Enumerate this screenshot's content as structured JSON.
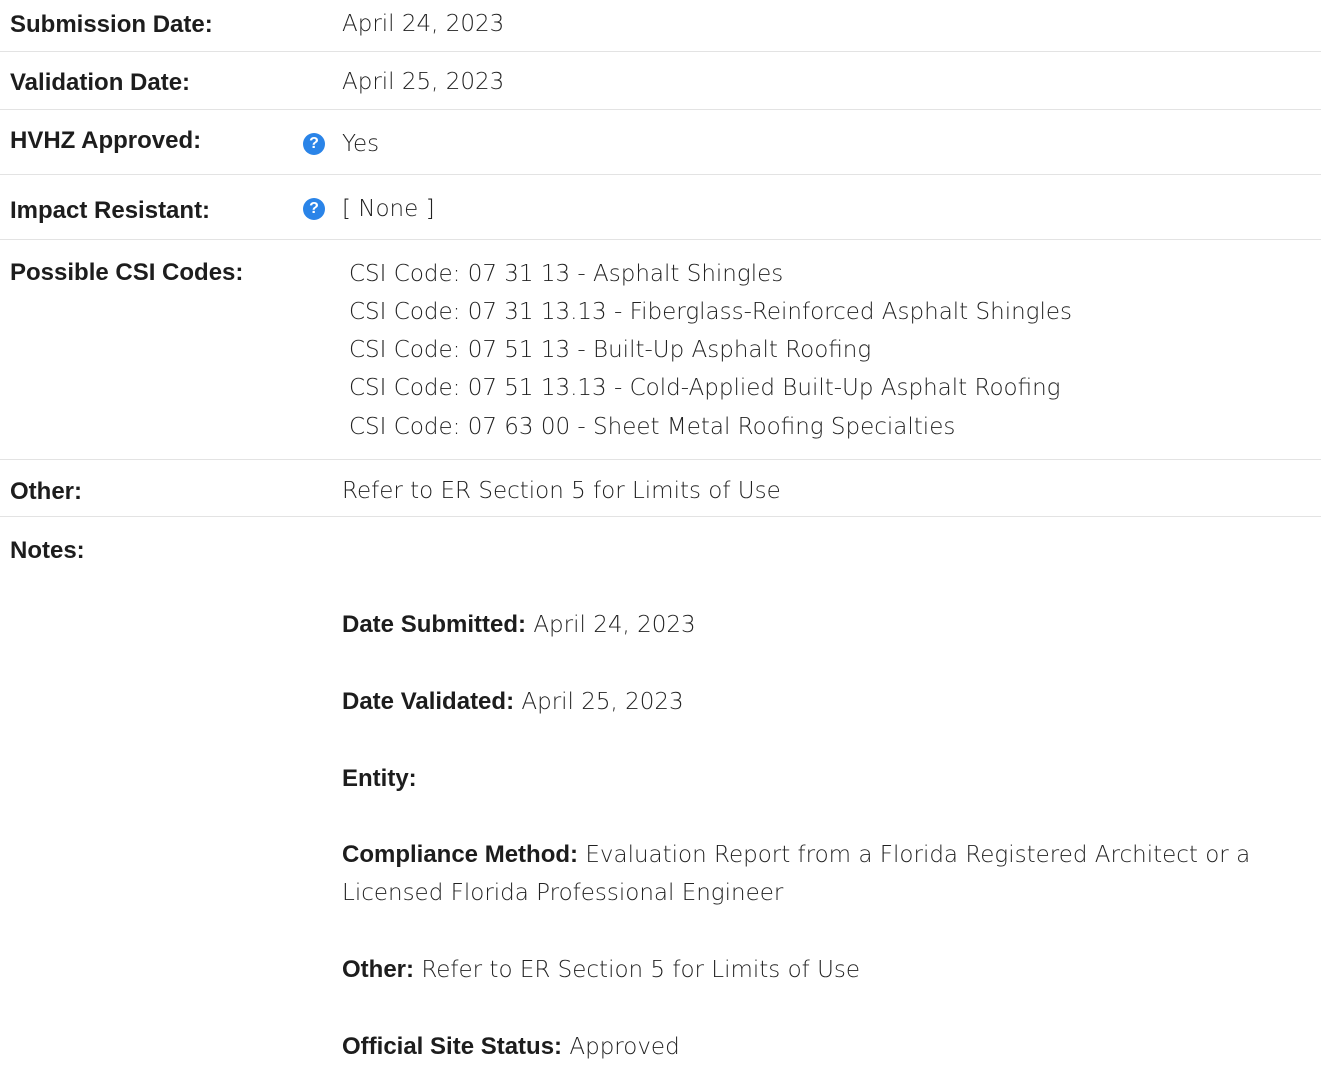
{
  "rows": {
    "submission": {
      "label": "Submission Date:",
      "value": "April 24, 2023"
    },
    "validation": {
      "label": "Validation Date:",
      "value": "April 25, 2023"
    },
    "hvhz": {
      "label": "HVHZ Approved:",
      "value": "Yes",
      "icon": "question-circle-icon"
    },
    "impact": {
      "label": "Impact Resistant:",
      "value": "[ None ]",
      "icon": "question-circle-icon"
    },
    "csi": {
      "label": "Possible CSI Codes:",
      "codes": [
        "CSI Code: 07 31 13 - Asphalt Shingles",
        "CSI Code: 07 31 13.13 - Fiberglass-Reinforced Asphalt Shingles",
        "CSI Code: 07 51 13 - Built-Up Asphalt Roofing",
        "CSI Code: 07 51 13.13 - Cold-Applied Built-Up Asphalt Roofing",
        "CSI Code: 07 63 00 - Sheet Metal Roofing Specialties"
      ]
    },
    "other": {
      "label": "Other:",
      "value": "Refer to ER Section 5 for Limits of Use"
    },
    "notes": {
      "label": "Notes:"
    }
  },
  "notes": {
    "date_submitted": {
      "label": "Date Submitted:",
      "value": "April 24, 2023"
    },
    "date_validated": {
      "label": "Date Validated:",
      "value": "April 25, 2023"
    },
    "entity": {
      "label": "Entity:",
      "value": ""
    },
    "compliance": {
      "label": "Compliance Method:",
      "value": "Evaluation Report from a Florida Registered Architect or a Licensed Florida Professional Engineer"
    },
    "other": {
      "label": "Other:",
      "value": "Refer to ER Section 5 for Limits of Use"
    },
    "site_status": {
      "label": "Official Site Status:",
      "value": "Approved"
    }
  },
  "colors": {
    "help_icon": "#2a84e8",
    "divider": "#e3e3e3"
  }
}
